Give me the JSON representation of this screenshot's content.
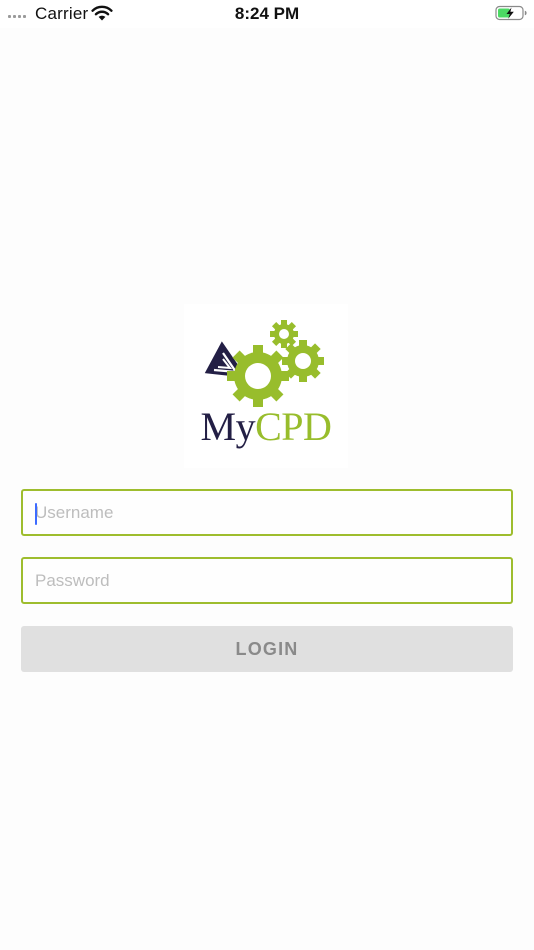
{
  "status_bar": {
    "carrier": "Carrier",
    "time": "8:24 PM",
    "icons": [
      "signal-dots-icon",
      "wifi-icon",
      "battery-charging-icon"
    ]
  },
  "logo": {
    "text_my": "My",
    "text_cpd": "CPD",
    "colors": {
      "navy": "#231f45",
      "green": "#98bd2c"
    }
  },
  "form": {
    "username": {
      "placeholder": "Username",
      "value": ""
    },
    "password": {
      "placeholder": "Password",
      "value": ""
    },
    "login_label": "LOGIN"
  },
  "colors": {
    "field_border": "#9ebd2e",
    "button_bg": "#e0e0e0",
    "button_text": "#8a8a8a",
    "caret": "#3d6bff"
  }
}
